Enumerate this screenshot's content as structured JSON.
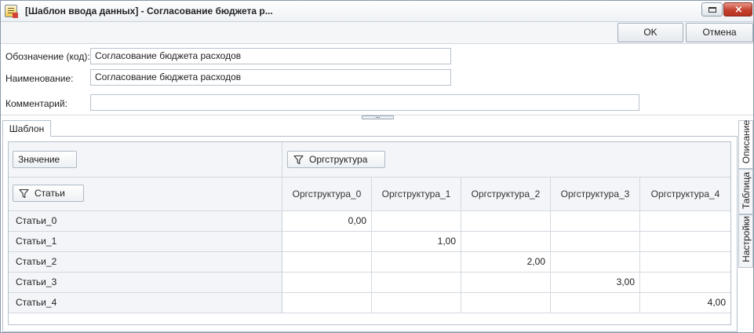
{
  "window": {
    "title": "[Шаблон ввода данных] - Согласование бюджета р...",
    "close_glyph": "×"
  },
  "toolbar": {
    "ok_label": "OK",
    "cancel_label": "Отмена"
  },
  "form": {
    "code_label": "Обозначение (код):",
    "code_value": "Согласование бюджета расходов",
    "name_label": "Наименование:",
    "name_value": "Согласование бюджета расходов",
    "comment_label": "Комментарий:",
    "comment_value": ""
  },
  "tabs": {
    "main_tab": "Шаблон",
    "side_tabs": [
      "Описание",
      "Таблица",
      "Настройки"
    ]
  },
  "pivot": {
    "data_field": "Значение",
    "column_field": "Оргструктура",
    "row_field": "Статьи",
    "columns": [
      "Оргструктура_0",
      "Оргструктура_1",
      "Оргструктура_2",
      "Оргструктура_3",
      "Оргструктура_4"
    ],
    "rows": [
      {
        "label": "Статьи_0",
        "cells": [
          "0,00",
          "",
          "",
          "",
          ""
        ]
      },
      {
        "label": "Статьи_1",
        "cells": [
          "",
          "1,00",
          "",
          "",
          ""
        ]
      },
      {
        "label": "Статьи_2",
        "cells": [
          "",
          "",
          "2,00",
          "",
          ""
        ]
      },
      {
        "label": "Статьи_3",
        "cells": [
          "",
          "",
          "",
          "3,00",
          ""
        ]
      },
      {
        "label": "Статьи_4",
        "cells": [
          "",
          "",
          "",
          "",
          "4,00"
        ]
      }
    ]
  },
  "icons": {
    "app": "template-app-icon",
    "restore": "restore-icon",
    "close": "close-icon",
    "filter": "filter-icon",
    "splitter_grip": "grip-icon"
  }
}
